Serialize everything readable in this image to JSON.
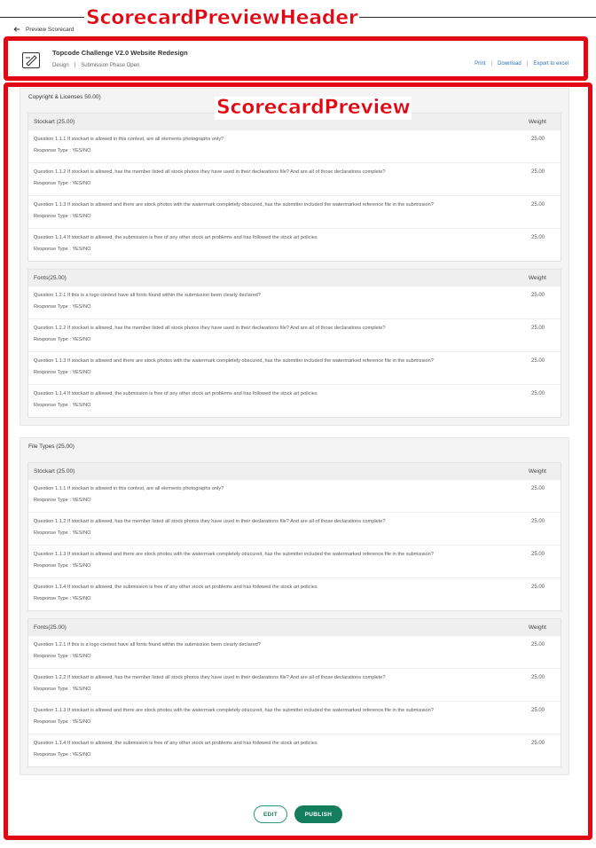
{
  "nav": {
    "back_label": "Preview Scorecard"
  },
  "header": {
    "title": "Topcode Challenge V2.0 Website Redesign",
    "track": "Design",
    "separator": "|",
    "phase": "Submission Phase Open",
    "links": [
      "Print",
      "Download",
      "Export to excel"
    ]
  },
  "annotations": {
    "header_label": "ScorecardPreviewHeader",
    "preview_label": "ScorecardPreview"
  },
  "weight_label": "Weight",
  "sections": [
    {
      "title": "Copyright & Licenses 50.00)",
      "groups": [
        {
          "title": "Stockart (25.00)",
          "questions": [
            {
              "text": "Question 1.1.1 If stockart is allowed in this contest, are all elements photographs only?",
              "response": "Response Type : YES/NO",
              "weight": "25.00"
            },
            {
              "text": "Question 1.1.2 If stockart is allowed, has the member listed all stock photos they have used in their declarations file? And are all of those declarations complete?",
              "response": "Response Type : YES/NO",
              "weight": "25.00"
            },
            {
              "text": "Question 1.1.3 If stockart is allowed and there are stock photos with the watermark completely obscured, has the submitter included the watermarked reference file in the submission?",
              "response": "Response Type : YES/NO",
              "weight": "25.00"
            },
            {
              "text": "Question 1.1.4 If stockart is allowed, the submission is free of any other stock art problems and has followed the stock art policies",
              "response": "Response Type : YES/NO",
              "weight": "25.00"
            }
          ]
        },
        {
          "title": "Fonts(25.00)",
          "questions": [
            {
              "text": "Question 1.2.1 If  this is a logo contest have all fonts found within the submission been clearly declared?",
              "response": "Response Type : YES/NO",
              "weight": "25.00"
            },
            {
              "text": "Question 1.2.2 If stockart is allowed, has the member listed all stock photos they have used in their declarations file? And are all of those declarations complete?",
              "response": "Response Type : YES/NO",
              "weight": "25.00"
            },
            {
              "text": "Question 1.1.3 If stockart is allowed and there are stock photos with the watermark completely obscured, has the submitter included the watermarked reference file in the submission?",
              "response": "Response Type : YES/NO",
              "weight": "25.00"
            },
            {
              "text": "Question 1.1.4 If stockart is allowed, the submission is free of any other stock art problems and has followed the stock art policies",
              "response": "Response Type : YES/NO",
              "weight": "25.00"
            }
          ]
        }
      ]
    },
    {
      "title": "File Types (25.00)",
      "groups": [
        {
          "title": "Stockart (25.00)",
          "questions": [
            {
              "text": "Question 1.1.1 If stockart is allowed in this contest, are all elements photographs only?",
              "response": "Response Type : YES/NO",
              "weight": "25.00"
            },
            {
              "text": "Question 1.1.2 If stockart is allowed, has the member listed all stock photos they have used in their declarations file? And are all of those declarations complete?",
              "response": "Response Type : YES/NO",
              "weight": "25.00"
            },
            {
              "text": "Question 1.1.3 If stockart is allowed and there are stock photos with the watermark completely obscured, has the submitter included the watermarked reference file in the submission?",
              "response": "Response Type : YES/NO",
              "weight": "25.00"
            },
            {
              "text": "Question 1.1.4 If stockart is allowed, the submission is free of any other stock art problems and has followed the stock art policies",
              "response": "Response Type : YES/NO",
              "weight": "25.00"
            }
          ]
        },
        {
          "title": "Fonts(25.00)",
          "questions": [
            {
              "text": "Question 1.2.1 If  this is a logo contest have all fonts found within the submission been clearly declared?",
              "response": "Response Type : YES/NO",
              "weight": "25.00"
            },
            {
              "text": "Question 1.2.2 If stockart is allowed, has the member listed all stock photos they have used in their declarations file? And are all of those declarations complete?",
              "response": "Response Type : YES/NO",
              "weight": "25.00"
            },
            {
              "text": "Question 1.1.3 If stockart is allowed and there are stock photos with the watermark completely obscured, has the submitter included the watermarked reference file in the submission?",
              "response": "Response Type : YES/NO",
              "weight": "25.00"
            },
            {
              "text": "Question 1.1.4 If stockart is allowed, the submission is free of any other stock art problems and has followed the stock art policies",
              "response": "Response Type : YES/NO",
              "weight": "25.00"
            }
          ]
        }
      ]
    }
  ],
  "actions": {
    "edit_label": "EDIT",
    "publish_label": "PUBLISH"
  },
  "colors": {
    "annotation": "#e30613",
    "primary": "#137d5c",
    "link": "#2b6fb7"
  }
}
